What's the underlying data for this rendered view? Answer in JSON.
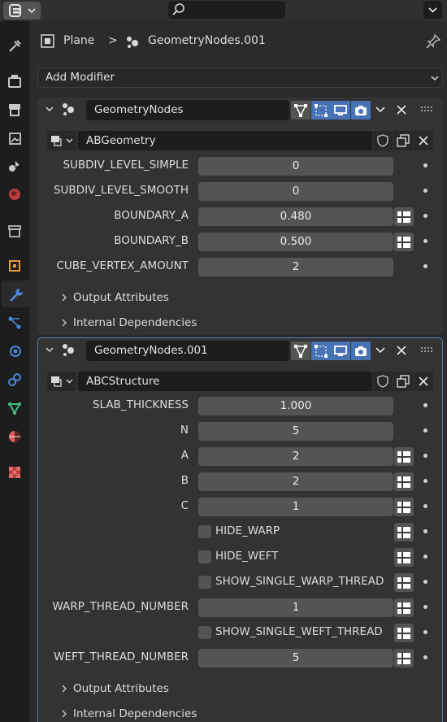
{
  "header": {
    "editor_type_icon": "properties-editor-icon",
    "search_icon": "search-icon",
    "search_value": ""
  },
  "tabs": [
    {
      "name": "tool-tab-icon",
      "color": "#c8c8c8"
    },
    {
      "name": "render-tab-icon",
      "color": "#c8c8c8"
    },
    {
      "name": "output-tab-icon",
      "color": "#c8c8c8"
    },
    {
      "name": "view-layer-tab-icon",
      "color": "#c8c8c8"
    },
    {
      "name": "scene-tab-icon",
      "color": "#c8c8c8"
    },
    {
      "name": "world-tab-icon",
      "color": "#d44444"
    },
    {
      "name": "collection-tab-icon",
      "color": "#c8c8c8"
    },
    {
      "name": "object-tab-icon",
      "color": "#e89a3c"
    },
    {
      "name": "modifier-tab-icon",
      "color": "#4a86d9"
    },
    {
      "name": "particles-tab-icon",
      "color": "#4a86d9"
    },
    {
      "name": "physics-tab-icon",
      "color": "#4a86d9"
    },
    {
      "name": "constraints-tab-icon",
      "color": "#4a86d9"
    },
    {
      "name": "data-tab-icon",
      "color": "#40c080"
    },
    {
      "name": "material-tab-icon",
      "color": "#e06060"
    },
    {
      "name": "texture-tab-icon",
      "color": "#d44444"
    }
  ],
  "breadcrumb": {
    "object": "Plane",
    "separator": ">",
    "modifier": "GeometryNodes.001"
  },
  "add_modifier": {
    "label": "Add Modifier"
  },
  "modifiers": [
    {
      "name": "GeometryNodes",
      "node_group": "ABGeometry",
      "inputs": [
        {
          "label": "SUBDIV_LEVEL_SIMPLE",
          "value": "0"
        },
        {
          "label": "SUBDIV_LEVEL_SMOOTH",
          "value": "0"
        },
        {
          "label": "BOUNDARY_A",
          "value": "0.480"
        },
        {
          "label": "BOUNDARY_B",
          "value": "0.500"
        },
        {
          "label": "CUBE_VERTEX_AMOUNT",
          "value": "2"
        }
      ],
      "subpanels": [
        "Output Attributes",
        "Internal Dependencies"
      ]
    },
    {
      "name": "GeometryNodes.001",
      "node_group": "ABCStructure",
      "inputs": [
        {
          "label": "SLAB_THICKNESS",
          "value": "1.000"
        },
        {
          "label": "N",
          "value": "5"
        },
        {
          "label": "A",
          "value": "2"
        },
        {
          "label": "B",
          "value": "2"
        },
        {
          "label": "C",
          "value": "1"
        },
        {
          "label": "HIDE_WARP",
          "value": ""
        },
        {
          "label": "HIDE_WEFT",
          "value": ""
        },
        {
          "label": "SHOW_SINGLE_WARP_THREAD",
          "value": ""
        },
        {
          "label": "WARP_THREAD_NUMBER",
          "value": "1"
        },
        {
          "label": "SHOW_SINGLE_WEFT_THREAD",
          "value": ""
        },
        {
          "label": "WEFT_THREAD_NUMBER",
          "value": "5"
        }
      ],
      "subpanels": [
        "Output Attributes",
        "Internal Dependencies"
      ]
    }
  ]
}
